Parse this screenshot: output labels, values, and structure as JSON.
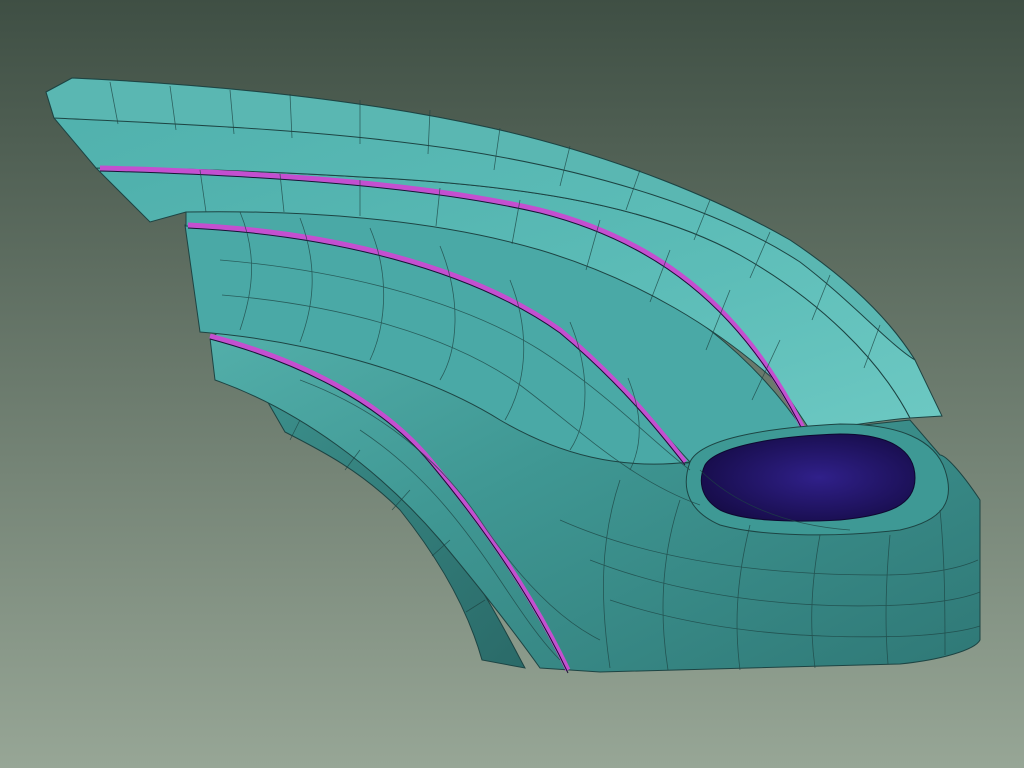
{
  "viewport": {
    "background_top": "#3f4f44",
    "background_bottom": "#97a696"
  },
  "model": {
    "surface_color": "#4aa9a6",
    "surface_light": "#63c2bd",
    "surface_shadow": "#2c6e6c",
    "wire_color": "#1d4443",
    "groove_color": "#c44fd0",
    "groove_highlight": "#e68bea",
    "cavity_color": "#2a1a70",
    "cavity_deep": "#1a0f50"
  }
}
